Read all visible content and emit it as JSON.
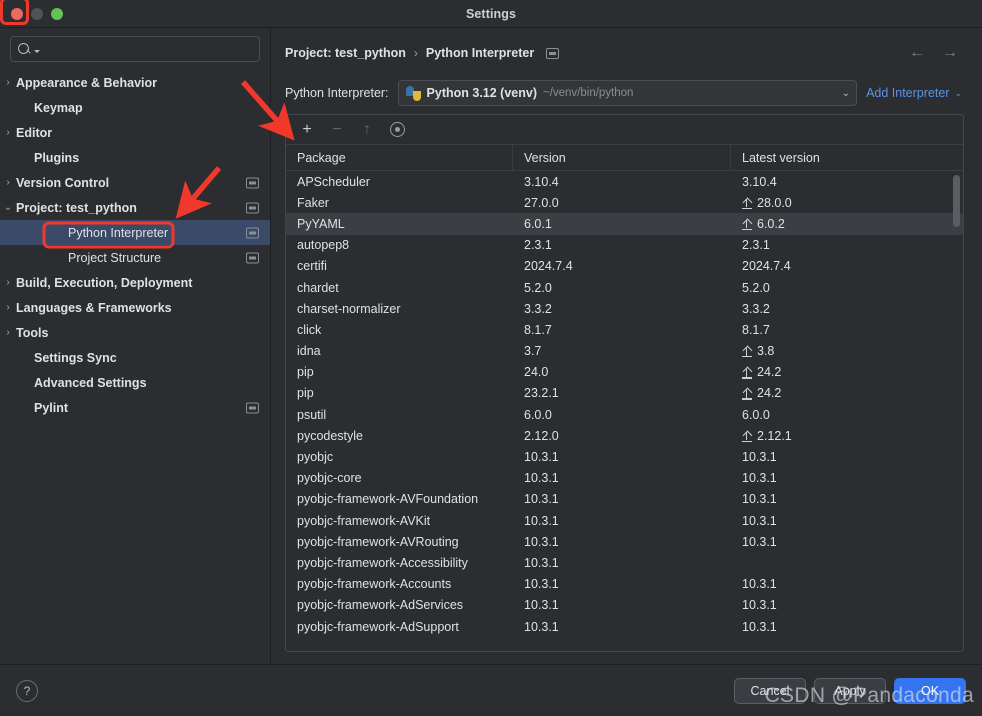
{
  "window": {
    "title": "Settings",
    "traffic_lights": [
      "close",
      "minimize",
      "zoom"
    ]
  },
  "sidebar": {
    "search": {
      "placeholder": "",
      "value": "",
      "icon": "search-icon"
    },
    "items": [
      {
        "label": "Appearance & Behavior",
        "arrow": "›",
        "bold": true,
        "depth": 0,
        "badge": false,
        "selected": false
      },
      {
        "label": "Keymap",
        "arrow": "",
        "bold": true,
        "depth": 1,
        "badge": false,
        "selected": false
      },
      {
        "label": "Editor",
        "arrow": "›",
        "bold": true,
        "depth": 0,
        "badge": false,
        "selected": false
      },
      {
        "label": "Plugins",
        "arrow": "",
        "bold": true,
        "depth": 1,
        "badge": false,
        "selected": false
      },
      {
        "label": "Version Control",
        "arrow": "›",
        "bold": true,
        "depth": 0,
        "badge": true,
        "selected": false
      },
      {
        "label": "Project: test_python",
        "arrow": "⌄",
        "bold": true,
        "depth": 0,
        "badge": true,
        "selected": false
      },
      {
        "label": "Python Interpreter",
        "arrow": "",
        "bold": false,
        "depth": 2,
        "badge": true,
        "selected": true
      },
      {
        "label": "Project Structure",
        "arrow": "",
        "bold": false,
        "depth": 2,
        "badge": true,
        "selected": false
      },
      {
        "label": "Build, Execution, Deployment",
        "arrow": "›",
        "bold": true,
        "depth": 0,
        "badge": false,
        "selected": false
      },
      {
        "label": "Languages & Frameworks",
        "arrow": "›",
        "bold": true,
        "depth": 0,
        "badge": false,
        "selected": false
      },
      {
        "label": "Tools",
        "arrow": "›",
        "bold": true,
        "depth": 0,
        "badge": false,
        "selected": false
      },
      {
        "label": "Settings Sync",
        "arrow": "",
        "bold": true,
        "depth": 1,
        "badge": false,
        "selected": false
      },
      {
        "label": "Advanced Settings",
        "arrow": "",
        "bold": true,
        "depth": 1,
        "badge": false,
        "selected": false
      },
      {
        "label": "Pylint",
        "arrow": "",
        "bold": true,
        "depth": 1,
        "badge": true,
        "selected": false
      }
    ]
  },
  "main": {
    "breadcrumb": {
      "root": "Project: test_python",
      "separator": "›",
      "current": "Python Interpreter",
      "badge_icon": "project-setting-badge-icon"
    },
    "nav": {
      "back": "←",
      "forward": "→"
    },
    "interpreter": {
      "label": "Python Interpreter:",
      "icon": "python-logo-icon",
      "name": "Python 3.12 (venv)",
      "path": "~/venv/bin/python",
      "caret": "⌄",
      "add_interpreter": "Add Interpreter",
      "add_caret": "⌄"
    },
    "toolbar": {
      "add": "+",
      "remove": "−",
      "upgrade": "↑",
      "show_early": "eye-icon"
    },
    "table": {
      "columns": [
        "Package",
        "Version",
        "Latest version"
      ],
      "rows": [
        {
          "package": "APScheduler",
          "version": "3.10.4",
          "latest": "3.10.4",
          "upgradable": false,
          "selected": false
        },
        {
          "package": "Faker",
          "version": "27.0.0",
          "latest": "28.0.0",
          "upgradable": true,
          "selected": false
        },
        {
          "package": "PyYAML",
          "version": "6.0.1",
          "latest": "6.0.2",
          "upgradable": true,
          "selected": true
        },
        {
          "package": "autopep8",
          "version": "2.3.1",
          "latest": "2.3.1",
          "upgradable": false,
          "selected": false
        },
        {
          "package": "certifi",
          "version": "2024.7.4",
          "latest": "2024.7.4",
          "upgradable": false,
          "selected": false
        },
        {
          "package": "chardet",
          "version": "5.2.0",
          "latest": "5.2.0",
          "upgradable": false,
          "selected": false
        },
        {
          "package": "charset-normalizer",
          "version": "3.3.2",
          "latest": "3.3.2",
          "upgradable": false,
          "selected": false
        },
        {
          "package": "click",
          "version": "8.1.7",
          "latest": "8.1.7",
          "upgradable": false,
          "selected": false
        },
        {
          "package": "idna",
          "version": "3.7",
          "latest": "3.8",
          "upgradable": true,
          "selected": false
        },
        {
          "package": "pip",
          "version": "24.0",
          "latest": "24.2",
          "upgradable": true,
          "selected": false
        },
        {
          "package": "pip",
          "version": "23.2.1",
          "latest": "24.2",
          "upgradable": true,
          "selected": false
        },
        {
          "package": "psutil",
          "version": "6.0.0",
          "latest": "6.0.0",
          "upgradable": false,
          "selected": false
        },
        {
          "package": "pycodestyle",
          "version": "2.12.0",
          "latest": "2.12.1",
          "upgradable": true,
          "selected": false
        },
        {
          "package": "pyobjc",
          "version": "10.3.1",
          "latest": "10.3.1",
          "upgradable": false,
          "selected": false
        },
        {
          "package": "pyobjc-core",
          "version": "10.3.1",
          "latest": "10.3.1",
          "upgradable": false,
          "selected": false
        },
        {
          "package": "pyobjc-framework-AVFoundation",
          "version": "10.3.1",
          "latest": "10.3.1",
          "upgradable": false,
          "selected": false
        },
        {
          "package": "pyobjc-framework-AVKit",
          "version": "10.3.1",
          "latest": "10.3.1",
          "upgradable": false,
          "selected": false
        },
        {
          "package": "pyobjc-framework-AVRouting",
          "version": "10.3.1",
          "latest": "10.3.1",
          "upgradable": false,
          "selected": false
        },
        {
          "package": "pyobjc-framework-Accessibility",
          "version": "10.3.1",
          "latest": "",
          "upgradable": false,
          "selected": false
        },
        {
          "package": "pyobjc-framework-Accounts",
          "version": "10.3.1",
          "latest": "10.3.1",
          "upgradable": false,
          "selected": false
        },
        {
          "package": "pyobjc-framework-AdServices",
          "version": "10.3.1",
          "latest": "10.3.1",
          "upgradable": false,
          "selected": false
        },
        {
          "package": "pyobjc-framework-AdSupport",
          "version": "10.3.1",
          "latest": "10.3.1",
          "upgradable": false,
          "selected": false
        }
      ]
    }
  },
  "footer": {
    "help": "?",
    "cancel": "Cancel",
    "apply": "Apply",
    "ok": "OK"
  },
  "watermark": {
    "text": "CSDN @Pandaconda"
  },
  "annotations": {
    "accent_color": "#f0392b",
    "highlight_plus_button": true,
    "highlight_python_interpreter_item": true,
    "arrows": 2
  }
}
